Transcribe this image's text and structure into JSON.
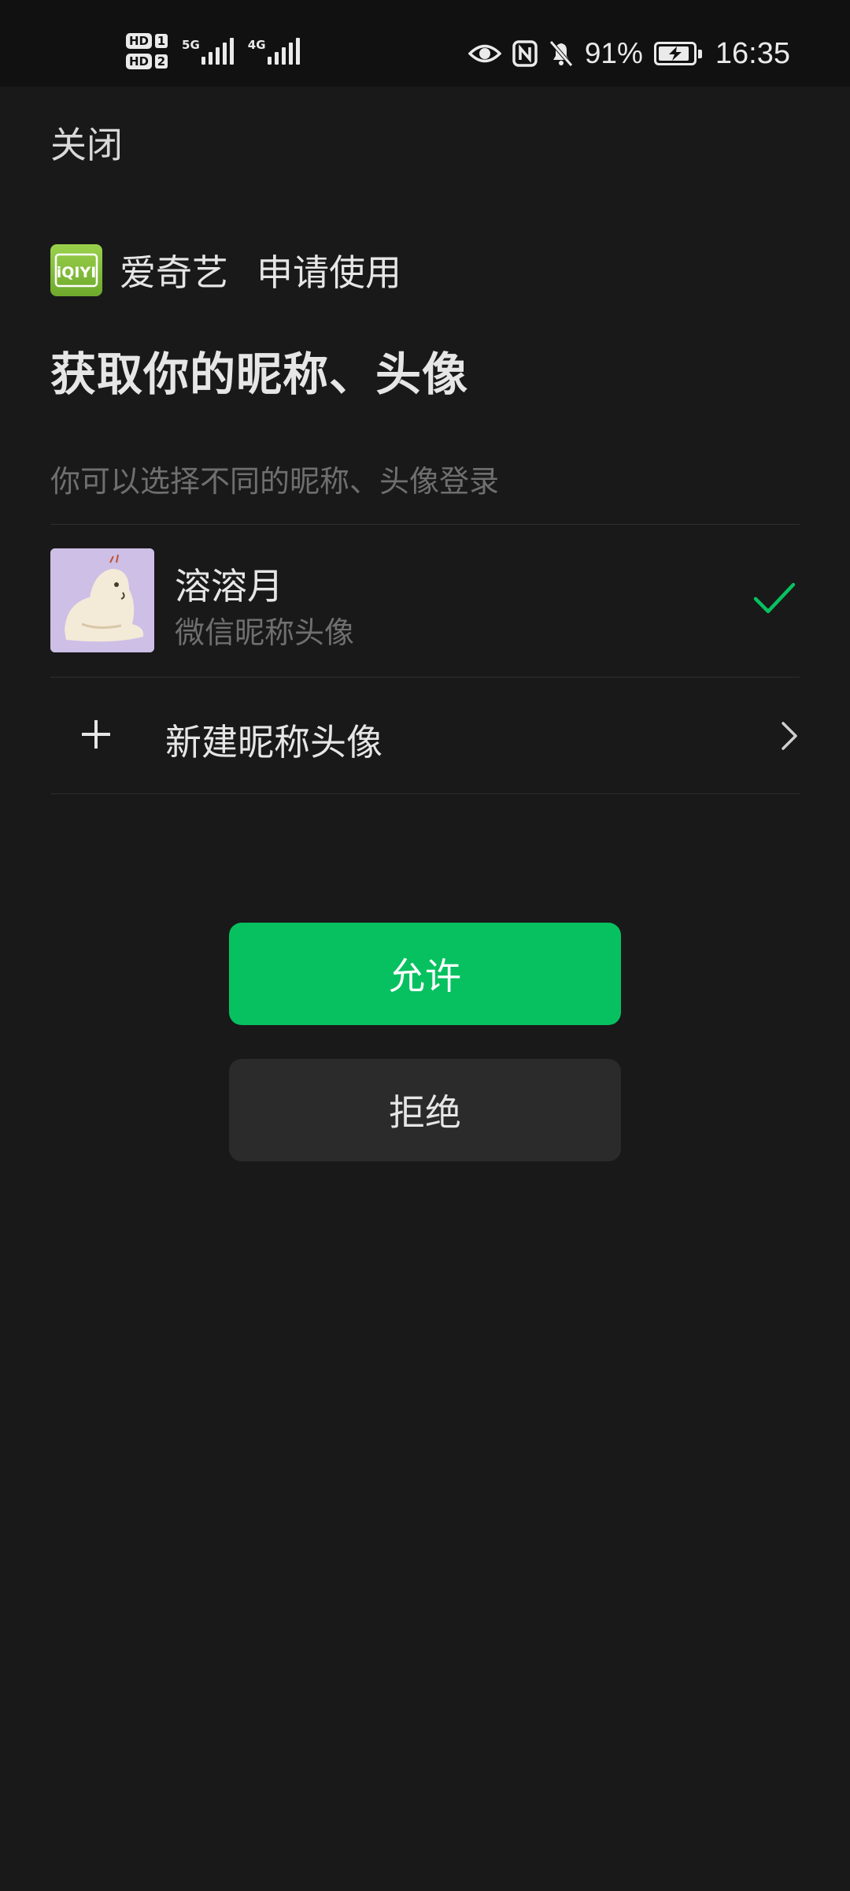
{
  "status_bar": {
    "hd1": "HD",
    "sim1": "1",
    "hd2": "HD",
    "sim2": "2",
    "network1": "5G",
    "network2": "4G",
    "battery_percent": "91%",
    "battery_level": 0.91,
    "time": "16:35",
    "icons": [
      "eye-icon",
      "nfc-icon",
      "bell-muted-icon",
      "battery-charging-icon"
    ]
  },
  "header": {
    "close_label": "关闭"
  },
  "request": {
    "app_name": "爱奇艺",
    "request_text": "申请使用",
    "logo_text": "iQIYI",
    "title": "获取你的昵称、头像",
    "hint": "你可以选择不同的昵称、头像登录"
  },
  "account": {
    "name": "溶溶月",
    "subtitle": "微信昵称头像",
    "selected": true
  },
  "new_profile": {
    "label": "新建昵称头像"
  },
  "actions": {
    "allow_label": "允许",
    "deny_label": "拒绝"
  },
  "colors": {
    "background": "#191919",
    "accent_green": "#07c160",
    "check_green": "#07c160",
    "deny_button": "#2b2b2b",
    "logo_green": "#8bc34a"
  }
}
